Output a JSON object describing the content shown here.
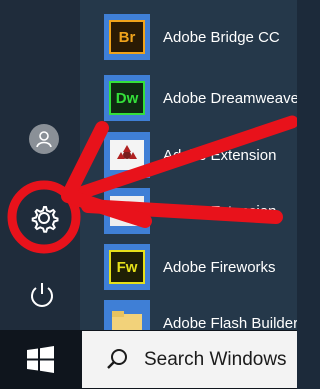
{
  "start_menu": {
    "apps": [
      {
        "badge": "Br",
        "name": "Adobe Bridge CC",
        "icon": "adobe-bridge-icon"
      },
      {
        "badge": "Dw",
        "name": "Adobe Dreamweaver",
        "icon": "adobe-dreamweaver-icon"
      },
      {
        "badge": "",
        "name": "Adobe Extension",
        "icon": "adobe-extension-icon"
      },
      {
        "badge": "",
        "name": "Adobe Extension",
        "icon": "adobe-extension-icon"
      },
      {
        "badge": "Fw",
        "name": "Adobe Fireworks",
        "icon": "adobe-fireworks-icon"
      },
      {
        "badge": "",
        "name": "Adobe Flash Builder",
        "icon": "folder-icon"
      }
    ],
    "sidebar_icons": [
      "user-avatar-icon",
      "gear-icon",
      "power-icon"
    ]
  },
  "taskbar": {
    "search_placeholder": "Search Windows",
    "start_icon": "windows-logo-icon",
    "search_icon": "search-icon"
  },
  "colors": {
    "tile_blue": "#3f7fd6",
    "annotation_red": "#e8121b",
    "bridge_badge": "#f0a31b",
    "dreamweaver_badge": "#34e03a",
    "fireworks_badge": "#e6e01a"
  }
}
